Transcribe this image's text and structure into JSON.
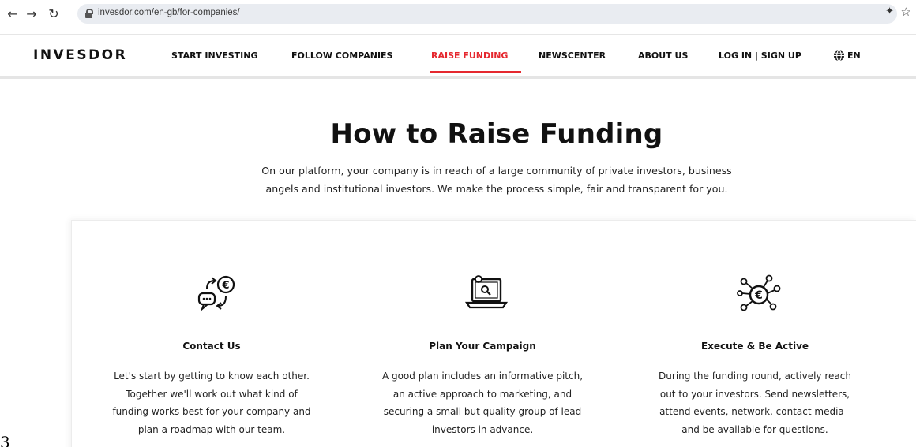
{
  "browser": {
    "back_icon": "arrow-left",
    "forward_icon": "arrow-right",
    "reload_icon": "reload",
    "url": "invesdor.com/en-gb/for-companies/",
    "extension_icon": "extension-icon",
    "bookmark_icon": "star"
  },
  "header": {
    "logo": "INVESDOR",
    "menu": [
      {
        "label": "START INVESTING"
      },
      {
        "label": "FOLLOW COMPANIES"
      },
      {
        "label": "RAISE FUNDING"
      },
      {
        "label": "NEWSCENTER"
      },
      {
        "label": "ABOUT US"
      },
      {
        "label": "LOG IN | SIGN UP"
      },
      {
        "label": "EN"
      }
    ],
    "active_color": "#e5282f"
  },
  "hero": {
    "title": "How to Raise Funding",
    "intro_line1": "On our platform, your company is in reach of a large community of private investors, business",
    "intro_line2": "angels and institutional investors. We make the process simple, fair and transparent for you."
  },
  "steps": [
    {
      "icon": "exchange-euro-icon",
      "title": "Contact Us",
      "lines": [
        "Let's start by getting to know each other.",
        "Together we'll work out what kind of",
        "funding works best for your company and",
        "plan a roadmap with our team."
      ]
    },
    {
      "icon": "laptop-search-icon",
      "title": "Plan Your Campaign",
      "lines": [
        "A good plan includes an informative pitch,",
        "an active approach to marketing, and",
        "securing a small but quality group of lead",
        "investors in advance."
      ]
    },
    {
      "icon": "euro-network-icon",
      "title": "Execute & Be Active",
      "lines": [
        "During the funding round, actively reach",
        "out to your investors. Send newsletters,",
        "attend events, network, contact media -",
        "and be available for questions."
      ]
    }
  ],
  "page_number": "3"
}
